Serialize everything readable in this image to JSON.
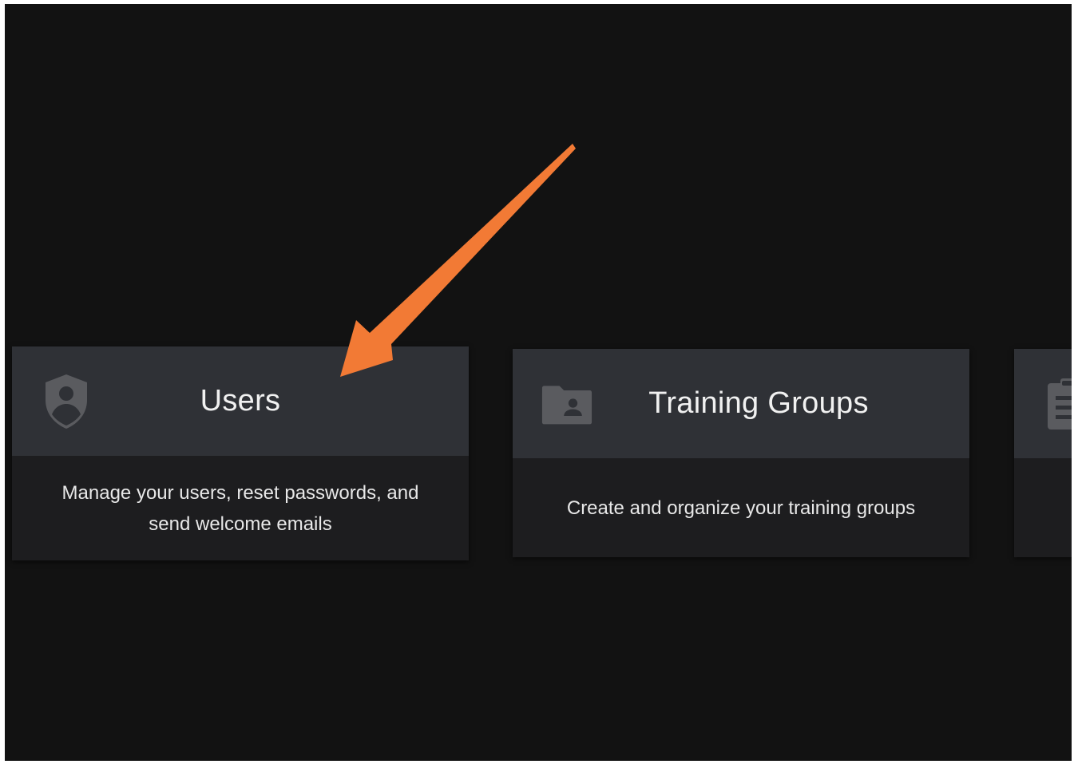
{
  "cards": [
    {
      "title": "Users",
      "description": "Manage your users, reset passwords, and send welcome emails",
      "icon": "shield-user-icon"
    },
    {
      "title": "Training Groups",
      "description": "Create and organize your training groups",
      "icon": "folder-user-icon"
    },
    {
      "title": "",
      "description": "",
      "icon": "clipboard-icon"
    }
  ],
  "colors": {
    "background": "#121212",
    "card_header": "#2f3136",
    "card_body": "#1d1d1f",
    "icon": "#5a5b5f",
    "arrow": "#f27a35"
  }
}
